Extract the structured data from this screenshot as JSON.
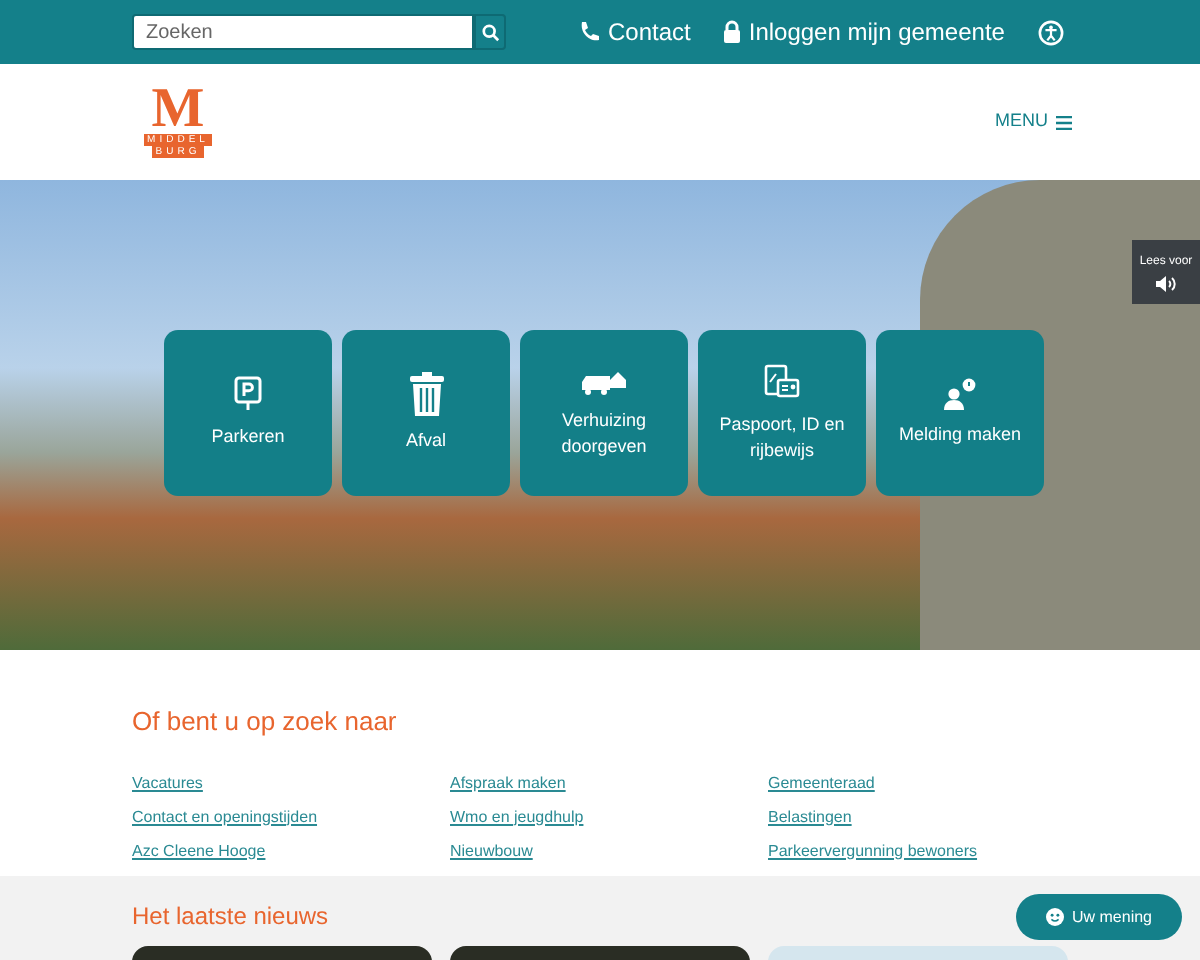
{
  "top_bar": {
    "search": {
      "placeholder": "Zoeken"
    },
    "links": [
      {
        "kind": "phone",
        "label": "Contact"
      },
      {
        "kind": "lock",
        "label": "Inloggen mijn gemeente"
      }
    ]
  },
  "header": {
    "logo": {
      "letter": "M",
      "line_1": "MIDDEL",
      "line_2": "BURG"
    },
    "menu": "MENU"
  },
  "read_aloud": "Lees voor",
  "tiles": [
    {
      "kind": "parking",
      "label": "Parkeren"
    },
    {
      "kind": "trash",
      "label": "Afval"
    },
    {
      "kind": "moving",
      "label": "Verhuizing doorgeven"
    },
    {
      "kind": "passport",
      "label": "Paspoort, ID en rijbewijs"
    },
    {
      "kind": "report",
      "label": "Melding maken"
    }
  ],
  "looking_for": {
    "title": "Of bent u op zoek naar",
    "columns": [
      [
        "Vacatures",
        "Contact en openingstijden",
        "Azc Cleene Hooge"
      ],
      [
        "Afspraak maken",
        "Wmo en jeugdhulp",
        "Nieuwbouw"
      ],
      [
        "Gemeenteraad",
        "Belastingen",
        "Parkeervergunning bewoners"
      ]
    ]
  },
  "news": {
    "title": "Het laatste nieuws",
    "cards": [
      {
        "kind": "photo"
      },
      {
        "kind": "photo"
      },
      {
        "kind": "poster"
      }
    ]
  },
  "feedback": "Uw mening"
}
